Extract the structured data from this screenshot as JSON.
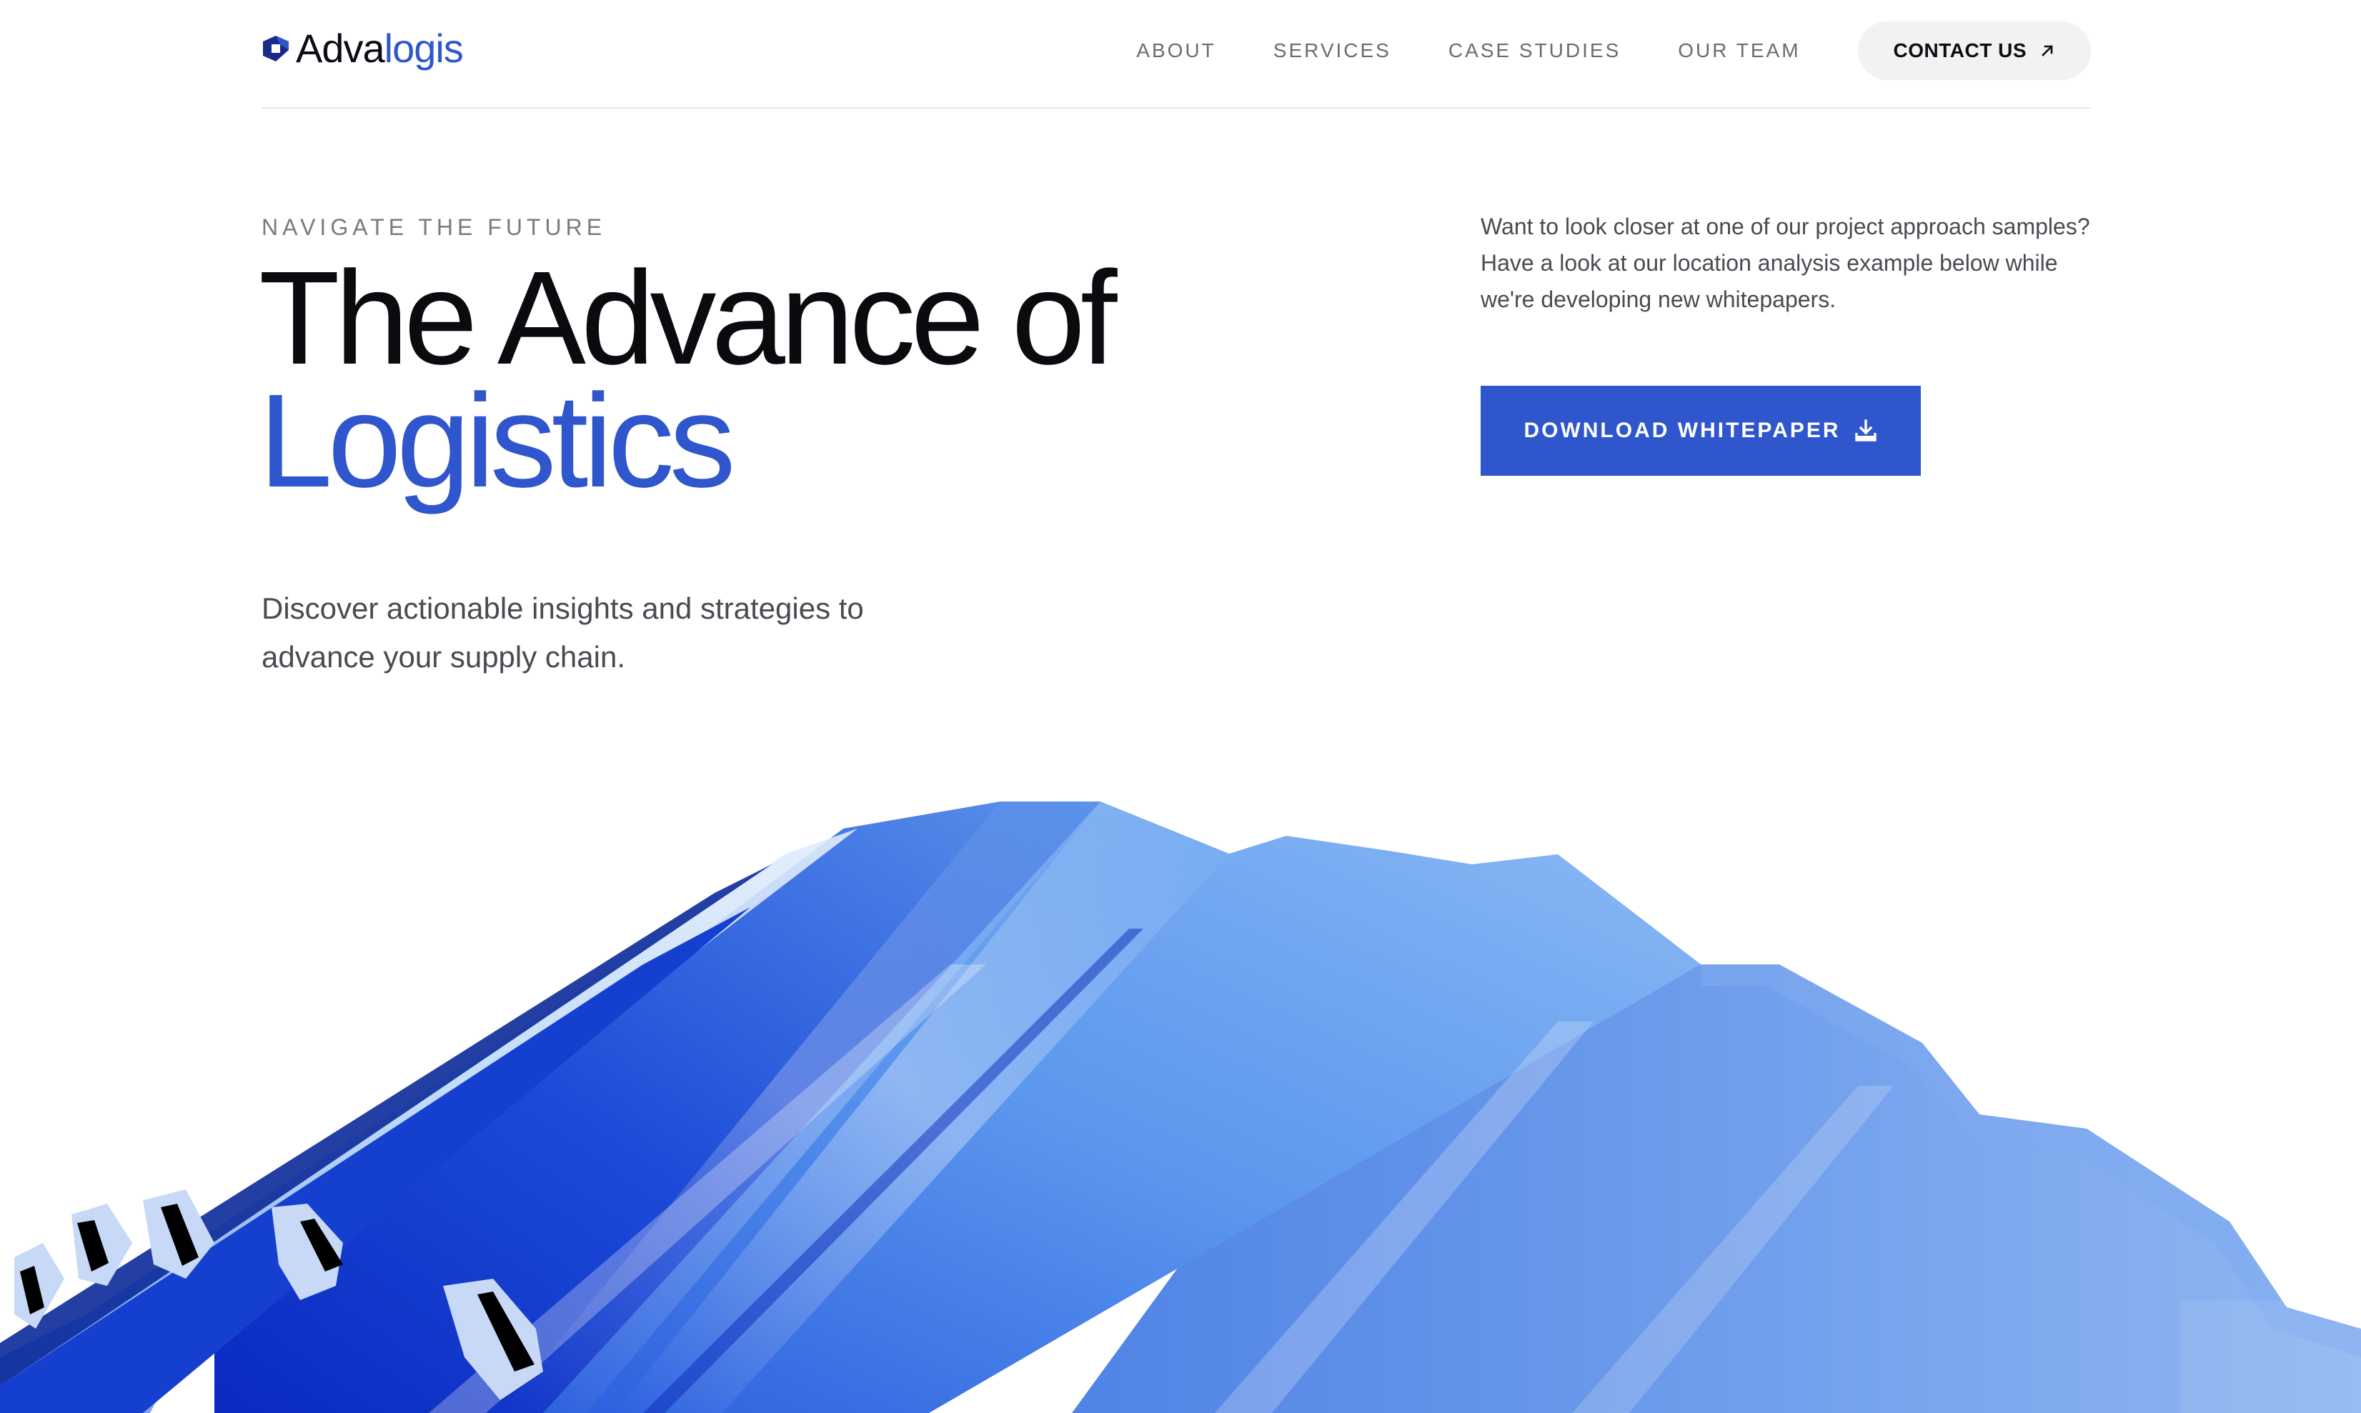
{
  "brand": {
    "name_part1": "Adva",
    "name_part2": "logis",
    "color_dark": "#0c0c14",
    "color_accent": "#2f56cc"
  },
  "nav": {
    "items": [
      {
        "label": "ABOUT"
      },
      {
        "label": "SERVICES"
      },
      {
        "label": "CASE STUDIES"
      },
      {
        "label": "OUR TEAM"
      }
    ],
    "contact_label": "CONTACT US",
    "contact_icon": "arrow-up-right-icon"
  },
  "hero": {
    "eyebrow": "NAVIGATE THE FUTURE",
    "headline_line1": "The Advance of",
    "headline_line2": "Logistics",
    "subtext": "Discover actionable insights and strategies to advance your supply chain.",
    "side_copy": "Want to look closer at one of our project approach samples? Have a look at our location analysis example below while we're developing new whitepapers.",
    "download_label": "DOWNLOAD WHITEPAPER",
    "download_icon": "download-icon"
  },
  "artwork": {
    "description_icon": "corrugated-blue-sheet-illustration",
    "colors": [
      "#0a2fc4",
      "#3f7fe8",
      "#9ec7f7",
      "#d7e8fb"
    ]
  }
}
